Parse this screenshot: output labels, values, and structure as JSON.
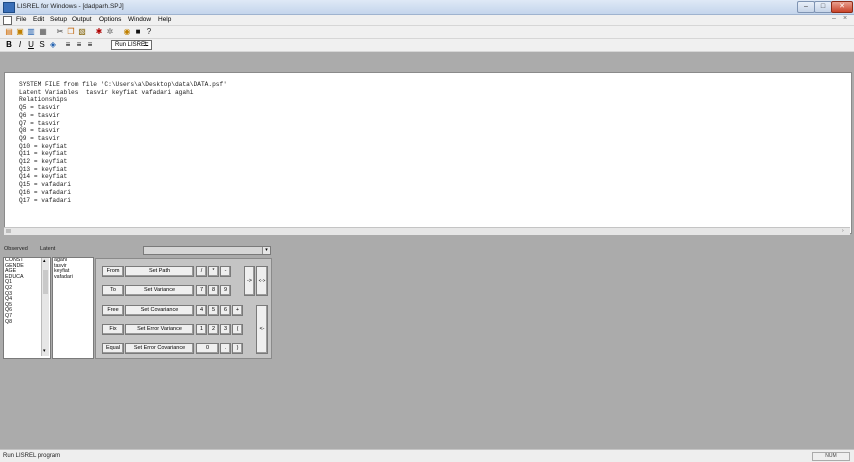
{
  "window": {
    "title": "LISREL for Windows - [dadparh.SPJ]"
  },
  "menu": [
    "File",
    "Edit",
    "Setup",
    "Output",
    "Options",
    "Window",
    "Help"
  ],
  "toolbar": {
    "run_label": "Run LISREL",
    "equals_label": "="
  },
  "editor": {
    "lines": [
      "SYSTEM FILE from file 'C:\\Users\\a\\Desktop\\data\\DATA.psf'",
      "Latent Variables  tasvir keyfiat vafadari agahi",
      "Relationships",
      "Q5 = tasvir",
      "Q6 = tasvir",
      "Q7 = tasvir",
      "Q8 = tasvir",
      "Q9 = tasvir",
      "Q10 = keyfiat",
      "Q11 = keyfiat",
      "Q12 = keyfiat",
      "Q13 = keyfiat",
      "Q14 = keyfiat",
      "Q15 = vafadari",
      "Q16 = vafadari",
      "Q17 = vafadari"
    ]
  },
  "panel": {
    "tab_observed": "Observed",
    "tab_latent": "Latent",
    "observed_vars": [
      "CONST",
      "GENDE",
      "AGE",
      "EDUCA",
      "Q1",
      "Q2",
      "Q3",
      "Q4",
      "Q5",
      "Q6",
      "Q7",
      "Q8"
    ],
    "latent_vars": [
      "agahi",
      "tasvir",
      "keyfiat",
      "vafadari"
    ]
  },
  "buttons": {
    "from": "From",
    "to": "To",
    "free": "Free",
    "fix": "Fix",
    "equal": "Equal",
    "set_path": "Set Path",
    "set_variance": "Set Variance",
    "set_covariance": "Set Covariance",
    "set_error_variance": "Set Error Variance",
    "set_error_covariance": "Set Error Covariance",
    "slash": "/",
    "star": "*",
    "minus": "-",
    "arrow_right": "->",
    "arrow_both": "<->",
    "arrow_left": "<-",
    "seven": "7",
    "eight": "8",
    "nine": "9",
    "four": "4",
    "five": "5",
    "six": "6",
    "plus": "+",
    "one": "1",
    "two": "2",
    "three": "3",
    "paren_open": "(",
    "zero": "0",
    "dot": ".",
    "paren_close": ")"
  },
  "status": {
    "text": "Run LISREL program",
    "indicator": "NUM"
  }
}
